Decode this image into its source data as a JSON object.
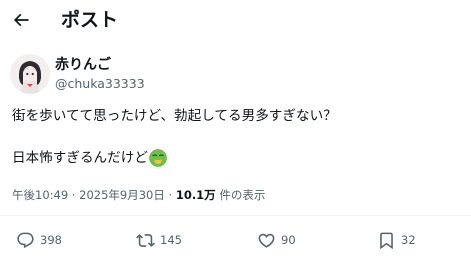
{
  "header": {
    "title": "ポスト"
  },
  "author": {
    "display_name": "赤りんご",
    "handle": "@chuka33333"
  },
  "tweet": {
    "line1": "街を歩いてて思ったけど、勃起してる男多すぎない？",
    "line2": "日本怖すぎるんだけど"
  },
  "meta": {
    "time": "午後10:49",
    "separator": " · ",
    "date": "2025年9月30日",
    "views_count": "10.1万",
    "views_label": " 件の表示"
  },
  "actions": {
    "replies": "398",
    "reposts": "145",
    "likes": "90",
    "bookmarks": "32"
  },
  "icons": {
    "back": "arrow-left-icon",
    "reply": "comment-icon",
    "repost": "repost-icon",
    "like": "heart-icon",
    "bookmark": "bookmark-icon",
    "emoji": "nauseated-face-emoji"
  },
  "colors": {
    "text": "#0f1419",
    "secondary": "#536471",
    "divider": "#eff3f4"
  }
}
